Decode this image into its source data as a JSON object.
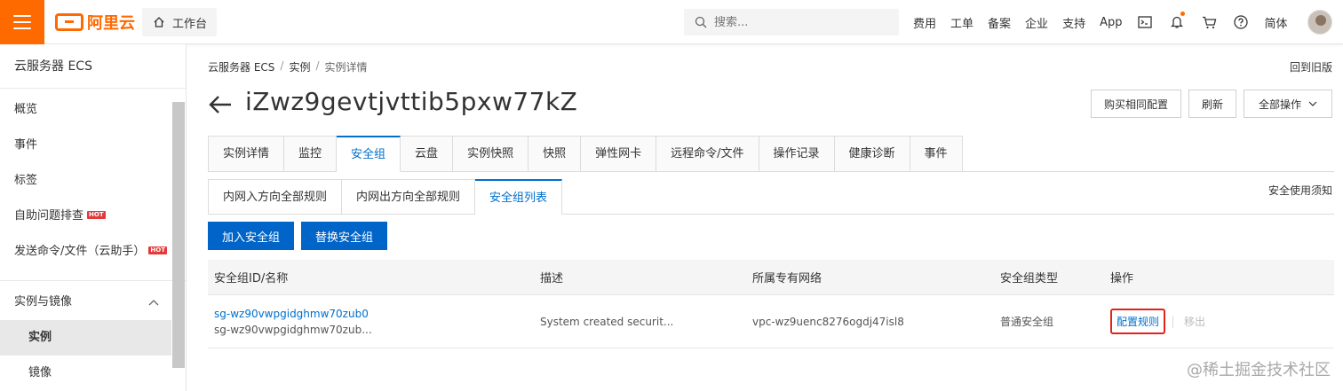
{
  "topbar": {
    "logo_text": "阿里云",
    "workbench": "工作台",
    "search_placeholder": "搜索...",
    "links": [
      "费用",
      "工单",
      "备案",
      "企业",
      "支持",
      "App"
    ],
    "language": "简体",
    "accent": "#ff6a00"
  },
  "sidebar": {
    "title": "云服务器 ECS",
    "items": [
      {
        "label": "概览"
      },
      {
        "label": "事件"
      },
      {
        "label": "标签"
      },
      {
        "label": "自助问题排查",
        "badge": "HOT"
      },
      {
        "label": "发送命令/文件（云助手）",
        "badge": "HOT"
      }
    ],
    "group": "实例与镜像",
    "sub_items": [
      "实例",
      "镜像"
    ]
  },
  "breadcrumb": [
    "云服务器 ECS",
    "实例",
    "实例详情"
  ],
  "old_version": "回到旧版",
  "page_title": "iZwz9gevtjvttib5pxw77kZ",
  "header_buttons": {
    "buy_same": "购买相同配置",
    "refresh": "刷新",
    "all_ops": "全部操作"
  },
  "tabs": [
    "实例详情",
    "监控",
    "安全组",
    "云盘",
    "实例快照",
    "快照",
    "弹性网卡",
    "远程命令/文件",
    "操作记录",
    "健康诊断",
    "事件"
  ],
  "active_tab": "安全组",
  "subtabs": [
    "内网入方向全部规则",
    "内网出方向全部规则",
    "安全组列表"
  ],
  "active_subtab": "安全组列表",
  "security_notice": "安全使用须知",
  "actions": {
    "add": "加入安全组",
    "replace": "替换安全组"
  },
  "table": {
    "headers": [
      "安全组ID/名称",
      "描述",
      "所属专有网络",
      "安全组类型",
      "操作"
    ],
    "rows": [
      {
        "id": "sg-wz90vwpgidghmw70zub0",
        "name": "sg-wz90vwpgidghmw70zub...",
        "desc": "System created securit...",
        "vpc": "vpc-wz9uenc8276ogdj47isl8",
        "type": "普通安全组",
        "op_config": "配置规则",
        "op_remove": "移出"
      }
    ]
  },
  "watermark": "@稀土掘金技术社区"
}
